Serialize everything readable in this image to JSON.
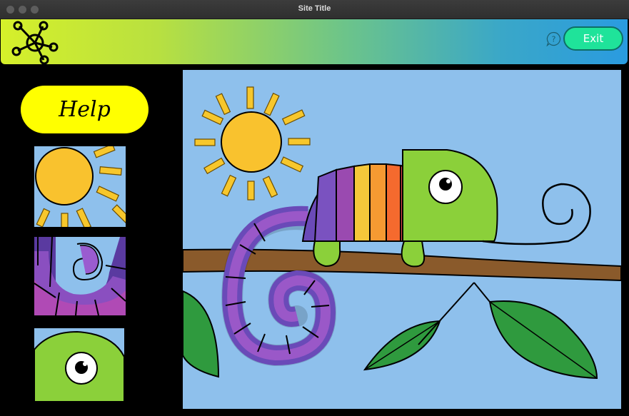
{
  "window": {
    "title": "Site Title"
  },
  "header": {
    "exit_label": "Exit",
    "help_icon_label": "?"
  },
  "sidebar": {
    "help_label": "Help"
  },
  "colors": {
    "header_gradient_start": "#d6f02a",
    "header_gradient_end": "#2a9be0",
    "exit_button": "#1fe39a",
    "help_button": "#ffff00",
    "sky": "#8ec0ec",
    "sun": "#f9c22e",
    "chameleon_head": "#8bd03a",
    "branch": "#8a5a2b",
    "leaf": "#2f9a3e"
  },
  "icons": {
    "logo": "network-hub-icon",
    "help": "question-bubble-icon"
  },
  "puzzle": {
    "tiles": [
      {
        "name": "sun-tile"
      },
      {
        "name": "tail-tile"
      },
      {
        "name": "eye-tile"
      }
    ]
  }
}
